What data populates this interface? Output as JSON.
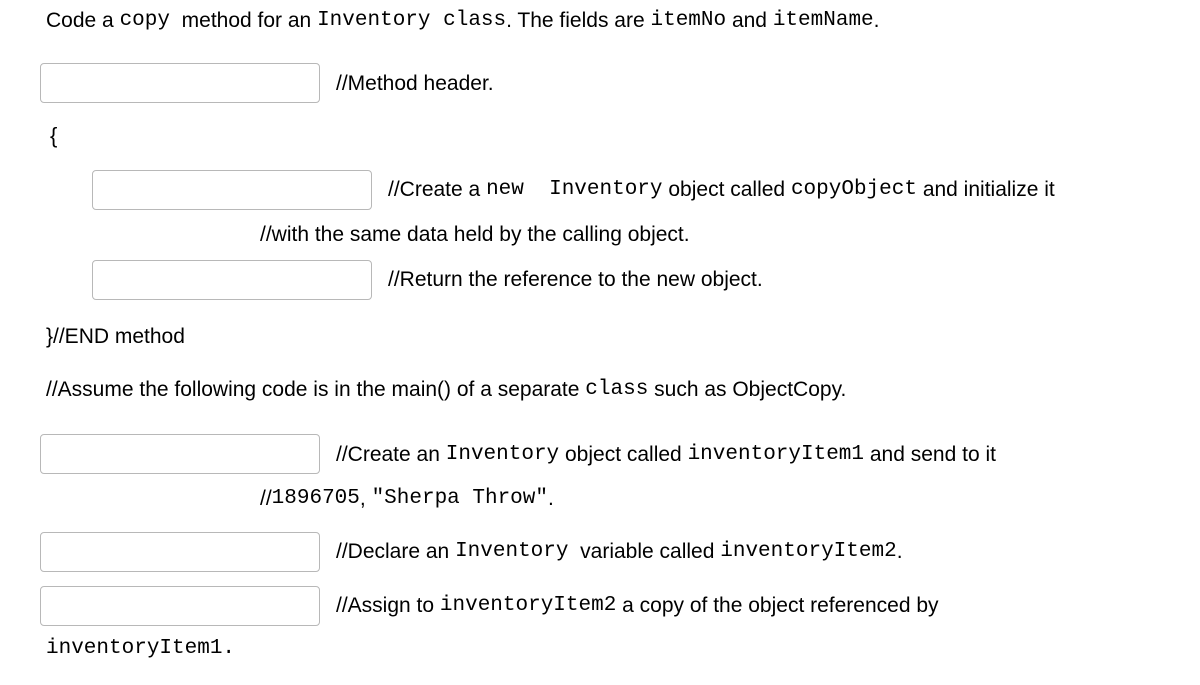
{
  "prompt": {
    "p1": "Code a ",
    "copy": "copy",
    "p2": "  method for an ",
    "inv": "Inventory",
    "sp": " ",
    "cls": "class",
    "p3": ". The fields are ",
    "itemNo": "itemNo",
    "and": " and ",
    "itemName": "itemName",
    "dot": "."
  },
  "l1_comment": "//Method header.",
  "brace_open": "{",
  "l2": {
    "c1": "//Create a ",
    "new": "new",
    "sp": "  ",
    "inv": "Inventory",
    "c2": " object called ",
    "copyObj": "copyObject",
    "c3": " and initialize it"
  },
  "l2b": "//with the same data held by the calling object.",
  "l3_comment": "//Return the reference to the new object.",
  "end_method": "}//END method",
  "assume": {
    "a1": "//Assume the following code is in the main() of a separate ",
    "cls": "class",
    "a2": " such as ObjectCopy."
  },
  "l4": {
    "c1": "//Create an ",
    "inv": "Inventory",
    "c2": " object called ",
    "item1": "inventoryItem1",
    "c3": " and send to it"
  },
  "l4b": {
    "pre": "//",
    "num": "1896705",
    "mid": ", ",
    "str": "\"Sherpa Throw\"",
    "dot": "."
  },
  "l5": {
    "c1": "//Declare an ",
    "inv": "Inventory",
    "c2": "  variable called ",
    "item2": "inventoryItem2",
    "dot": "."
  },
  "l6": {
    "c1": "//Assign to ",
    "item2": "inventoryItem2",
    "c2": " a copy of the object referenced by"
  },
  "inv1": "inventoryItem1."
}
